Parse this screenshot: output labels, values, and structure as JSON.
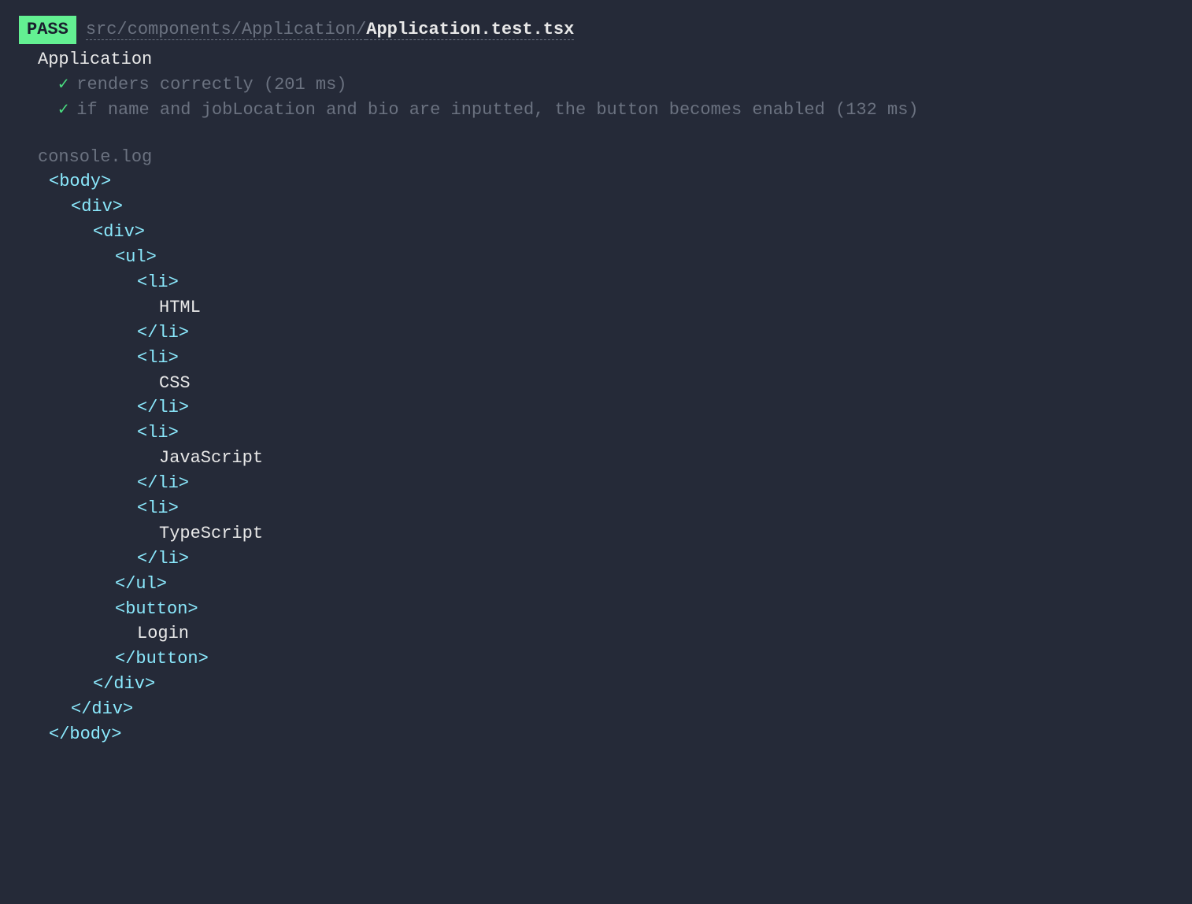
{
  "header": {
    "status_badge": "PASS",
    "file_dir": "src/components/Application/",
    "file_name": "Application.test.tsx"
  },
  "suite": {
    "name": "Application",
    "tests": [
      {
        "pass": "✓",
        "label": "renders correctly (201 ms)"
      },
      {
        "pass": "✓",
        "label": "if name and jobLocation and bio are inputted, the button becomes enabled (132 ms)"
      }
    ]
  },
  "console": {
    "label": "console.log",
    "dom": {
      "tags": {
        "body_open": "<body>",
        "body_close": "</body>",
        "div_open": "<div>",
        "div_close": "</div>",
        "ul_open": "<ul>",
        "ul_close": "</ul>",
        "li_open": "<li>",
        "li_close": "</li>",
        "button_open": "<button>",
        "button_close": "</button>"
      },
      "list_items": [
        "HTML",
        "CSS",
        "JavaScript",
        "TypeScript"
      ],
      "button_text": "Login"
    }
  }
}
